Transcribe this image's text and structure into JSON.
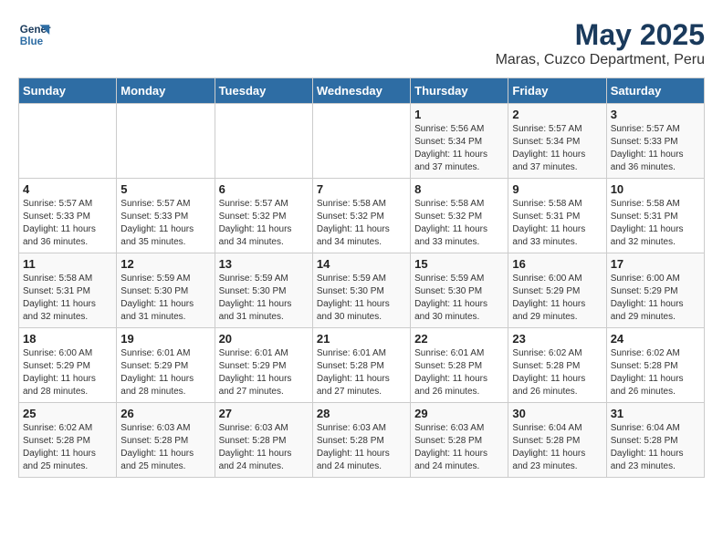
{
  "header": {
    "logo_line1": "General",
    "logo_line2": "Blue",
    "title": "May 2025",
    "subtitle": "Maras, Cuzco Department, Peru"
  },
  "days_of_week": [
    "Sunday",
    "Monday",
    "Tuesday",
    "Wednesday",
    "Thursday",
    "Friday",
    "Saturday"
  ],
  "weeks": [
    [
      {
        "num": "",
        "detail": ""
      },
      {
        "num": "",
        "detail": ""
      },
      {
        "num": "",
        "detail": ""
      },
      {
        "num": "",
        "detail": ""
      },
      {
        "num": "1",
        "detail": "Sunrise: 5:56 AM\nSunset: 5:34 PM\nDaylight: 11 hours and 37 minutes."
      },
      {
        "num": "2",
        "detail": "Sunrise: 5:57 AM\nSunset: 5:34 PM\nDaylight: 11 hours and 37 minutes."
      },
      {
        "num": "3",
        "detail": "Sunrise: 5:57 AM\nSunset: 5:33 PM\nDaylight: 11 hours and 36 minutes."
      }
    ],
    [
      {
        "num": "4",
        "detail": "Sunrise: 5:57 AM\nSunset: 5:33 PM\nDaylight: 11 hours and 36 minutes."
      },
      {
        "num": "5",
        "detail": "Sunrise: 5:57 AM\nSunset: 5:33 PM\nDaylight: 11 hours and 35 minutes."
      },
      {
        "num": "6",
        "detail": "Sunrise: 5:57 AM\nSunset: 5:32 PM\nDaylight: 11 hours and 34 minutes."
      },
      {
        "num": "7",
        "detail": "Sunrise: 5:58 AM\nSunset: 5:32 PM\nDaylight: 11 hours and 34 minutes."
      },
      {
        "num": "8",
        "detail": "Sunrise: 5:58 AM\nSunset: 5:32 PM\nDaylight: 11 hours and 33 minutes."
      },
      {
        "num": "9",
        "detail": "Sunrise: 5:58 AM\nSunset: 5:31 PM\nDaylight: 11 hours and 33 minutes."
      },
      {
        "num": "10",
        "detail": "Sunrise: 5:58 AM\nSunset: 5:31 PM\nDaylight: 11 hours and 32 minutes."
      }
    ],
    [
      {
        "num": "11",
        "detail": "Sunrise: 5:58 AM\nSunset: 5:31 PM\nDaylight: 11 hours and 32 minutes."
      },
      {
        "num": "12",
        "detail": "Sunrise: 5:59 AM\nSunset: 5:30 PM\nDaylight: 11 hours and 31 minutes."
      },
      {
        "num": "13",
        "detail": "Sunrise: 5:59 AM\nSunset: 5:30 PM\nDaylight: 11 hours and 31 minutes."
      },
      {
        "num": "14",
        "detail": "Sunrise: 5:59 AM\nSunset: 5:30 PM\nDaylight: 11 hours and 30 minutes."
      },
      {
        "num": "15",
        "detail": "Sunrise: 5:59 AM\nSunset: 5:30 PM\nDaylight: 11 hours and 30 minutes."
      },
      {
        "num": "16",
        "detail": "Sunrise: 6:00 AM\nSunset: 5:29 PM\nDaylight: 11 hours and 29 minutes."
      },
      {
        "num": "17",
        "detail": "Sunrise: 6:00 AM\nSunset: 5:29 PM\nDaylight: 11 hours and 29 minutes."
      }
    ],
    [
      {
        "num": "18",
        "detail": "Sunrise: 6:00 AM\nSunset: 5:29 PM\nDaylight: 11 hours and 28 minutes."
      },
      {
        "num": "19",
        "detail": "Sunrise: 6:01 AM\nSunset: 5:29 PM\nDaylight: 11 hours and 28 minutes."
      },
      {
        "num": "20",
        "detail": "Sunrise: 6:01 AM\nSunset: 5:29 PM\nDaylight: 11 hours and 27 minutes."
      },
      {
        "num": "21",
        "detail": "Sunrise: 6:01 AM\nSunset: 5:28 PM\nDaylight: 11 hours and 27 minutes."
      },
      {
        "num": "22",
        "detail": "Sunrise: 6:01 AM\nSunset: 5:28 PM\nDaylight: 11 hours and 26 minutes."
      },
      {
        "num": "23",
        "detail": "Sunrise: 6:02 AM\nSunset: 5:28 PM\nDaylight: 11 hours and 26 minutes."
      },
      {
        "num": "24",
        "detail": "Sunrise: 6:02 AM\nSunset: 5:28 PM\nDaylight: 11 hours and 26 minutes."
      }
    ],
    [
      {
        "num": "25",
        "detail": "Sunrise: 6:02 AM\nSunset: 5:28 PM\nDaylight: 11 hours and 25 minutes."
      },
      {
        "num": "26",
        "detail": "Sunrise: 6:03 AM\nSunset: 5:28 PM\nDaylight: 11 hours and 25 minutes."
      },
      {
        "num": "27",
        "detail": "Sunrise: 6:03 AM\nSunset: 5:28 PM\nDaylight: 11 hours and 24 minutes."
      },
      {
        "num": "28",
        "detail": "Sunrise: 6:03 AM\nSunset: 5:28 PM\nDaylight: 11 hours and 24 minutes."
      },
      {
        "num": "29",
        "detail": "Sunrise: 6:03 AM\nSunset: 5:28 PM\nDaylight: 11 hours and 24 minutes."
      },
      {
        "num": "30",
        "detail": "Sunrise: 6:04 AM\nSunset: 5:28 PM\nDaylight: 11 hours and 23 minutes."
      },
      {
        "num": "31",
        "detail": "Sunrise: 6:04 AM\nSunset: 5:28 PM\nDaylight: 11 hours and 23 minutes."
      }
    ]
  ]
}
